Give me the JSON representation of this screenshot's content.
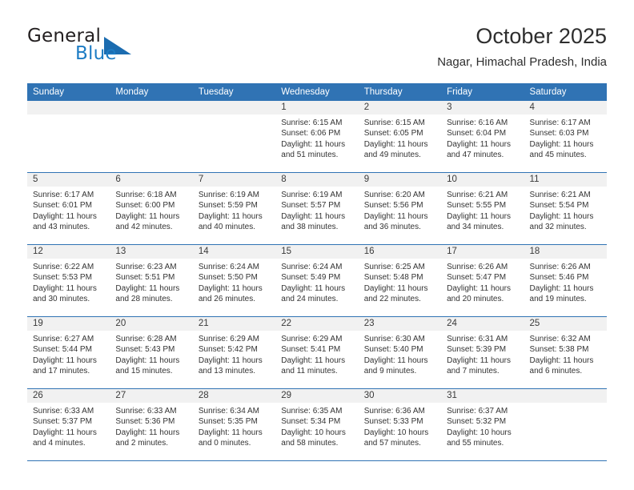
{
  "brand": {
    "name_part1": "General",
    "name_part2": "Blue",
    "triangle_color": "#1b6cb0",
    "blue_text_color": "#1d7cc4"
  },
  "header": {
    "title": "October 2025",
    "subtitle": "Nagar, Himachal Pradesh, India"
  },
  "theme": {
    "header_bg": "#3073b4",
    "daynum_band_bg": "#f1f1f1",
    "grid_line": "#3073b4",
    "text": "#333333"
  },
  "calendar": {
    "weekday_headers": [
      "Sunday",
      "Monday",
      "Tuesday",
      "Wednesday",
      "Thursday",
      "Friday",
      "Saturday"
    ],
    "weeks": [
      [
        {
          "day": "",
          "sunrise": "",
          "sunset": "",
          "daylight_line1": "",
          "daylight_line2": "",
          "empty": true
        },
        {
          "day": "",
          "sunrise": "",
          "sunset": "",
          "daylight_line1": "",
          "daylight_line2": "",
          "empty": true
        },
        {
          "day": "",
          "sunrise": "",
          "sunset": "",
          "daylight_line1": "",
          "daylight_line2": "",
          "empty": true
        },
        {
          "day": "1",
          "sunrise": "Sunrise: 6:15 AM",
          "sunset": "Sunset: 6:06 PM",
          "daylight_line1": "Daylight: 11 hours",
          "daylight_line2": "and 51 minutes."
        },
        {
          "day": "2",
          "sunrise": "Sunrise: 6:15 AM",
          "sunset": "Sunset: 6:05 PM",
          "daylight_line1": "Daylight: 11 hours",
          "daylight_line2": "and 49 minutes."
        },
        {
          "day": "3",
          "sunrise": "Sunrise: 6:16 AM",
          "sunset": "Sunset: 6:04 PM",
          "daylight_line1": "Daylight: 11 hours",
          "daylight_line2": "and 47 minutes."
        },
        {
          "day": "4",
          "sunrise": "Sunrise: 6:17 AM",
          "sunset": "Sunset: 6:03 PM",
          "daylight_line1": "Daylight: 11 hours",
          "daylight_line2": "and 45 minutes."
        }
      ],
      [
        {
          "day": "5",
          "sunrise": "Sunrise: 6:17 AM",
          "sunset": "Sunset: 6:01 PM",
          "daylight_line1": "Daylight: 11 hours",
          "daylight_line2": "and 43 minutes."
        },
        {
          "day": "6",
          "sunrise": "Sunrise: 6:18 AM",
          "sunset": "Sunset: 6:00 PM",
          "daylight_line1": "Daylight: 11 hours",
          "daylight_line2": "and 42 minutes."
        },
        {
          "day": "7",
          "sunrise": "Sunrise: 6:19 AM",
          "sunset": "Sunset: 5:59 PM",
          "daylight_line1": "Daylight: 11 hours",
          "daylight_line2": "and 40 minutes."
        },
        {
          "day": "8",
          "sunrise": "Sunrise: 6:19 AM",
          "sunset": "Sunset: 5:57 PM",
          "daylight_line1": "Daylight: 11 hours",
          "daylight_line2": "and 38 minutes."
        },
        {
          "day": "9",
          "sunrise": "Sunrise: 6:20 AM",
          "sunset": "Sunset: 5:56 PM",
          "daylight_line1": "Daylight: 11 hours",
          "daylight_line2": "and 36 minutes."
        },
        {
          "day": "10",
          "sunrise": "Sunrise: 6:21 AM",
          "sunset": "Sunset: 5:55 PM",
          "daylight_line1": "Daylight: 11 hours",
          "daylight_line2": "and 34 minutes."
        },
        {
          "day": "11",
          "sunrise": "Sunrise: 6:21 AM",
          "sunset": "Sunset: 5:54 PM",
          "daylight_line1": "Daylight: 11 hours",
          "daylight_line2": "and 32 minutes."
        }
      ],
      [
        {
          "day": "12",
          "sunrise": "Sunrise: 6:22 AM",
          "sunset": "Sunset: 5:53 PM",
          "daylight_line1": "Daylight: 11 hours",
          "daylight_line2": "and 30 minutes."
        },
        {
          "day": "13",
          "sunrise": "Sunrise: 6:23 AM",
          "sunset": "Sunset: 5:51 PM",
          "daylight_line1": "Daylight: 11 hours",
          "daylight_line2": "and 28 minutes."
        },
        {
          "day": "14",
          "sunrise": "Sunrise: 6:24 AM",
          "sunset": "Sunset: 5:50 PM",
          "daylight_line1": "Daylight: 11 hours",
          "daylight_line2": "and 26 minutes."
        },
        {
          "day": "15",
          "sunrise": "Sunrise: 6:24 AM",
          "sunset": "Sunset: 5:49 PM",
          "daylight_line1": "Daylight: 11 hours",
          "daylight_line2": "and 24 minutes."
        },
        {
          "day": "16",
          "sunrise": "Sunrise: 6:25 AM",
          "sunset": "Sunset: 5:48 PM",
          "daylight_line1": "Daylight: 11 hours",
          "daylight_line2": "and 22 minutes."
        },
        {
          "day": "17",
          "sunrise": "Sunrise: 6:26 AM",
          "sunset": "Sunset: 5:47 PM",
          "daylight_line1": "Daylight: 11 hours",
          "daylight_line2": "and 20 minutes."
        },
        {
          "day": "18",
          "sunrise": "Sunrise: 6:26 AM",
          "sunset": "Sunset: 5:46 PM",
          "daylight_line1": "Daylight: 11 hours",
          "daylight_line2": "and 19 minutes."
        }
      ],
      [
        {
          "day": "19",
          "sunrise": "Sunrise: 6:27 AM",
          "sunset": "Sunset: 5:44 PM",
          "daylight_line1": "Daylight: 11 hours",
          "daylight_line2": "and 17 minutes."
        },
        {
          "day": "20",
          "sunrise": "Sunrise: 6:28 AM",
          "sunset": "Sunset: 5:43 PM",
          "daylight_line1": "Daylight: 11 hours",
          "daylight_line2": "and 15 minutes."
        },
        {
          "day": "21",
          "sunrise": "Sunrise: 6:29 AM",
          "sunset": "Sunset: 5:42 PM",
          "daylight_line1": "Daylight: 11 hours",
          "daylight_line2": "and 13 minutes."
        },
        {
          "day": "22",
          "sunrise": "Sunrise: 6:29 AM",
          "sunset": "Sunset: 5:41 PM",
          "daylight_line1": "Daylight: 11 hours",
          "daylight_line2": "and 11 minutes."
        },
        {
          "day": "23",
          "sunrise": "Sunrise: 6:30 AM",
          "sunset": "Sunset: 5:40 PM",
          "daylight_line1": "Daylight: 11 hours",
          "daylight_line2": "and 9 minutes."
        },
        {
          "day": "24",
          "sunrise": "Sunrise: 6:31 AM",
          "sunset": "Sunset: 5:39 PM",
          "daylight_line1": "Daylight: 11 hours",
          "daylight_line2": "and 7 minutes."
        },
        {
          "day": "25",
          "sunrise": "Sunrise: 6:32 AM",
          "sunset": "Sunset: 5:38 PM",
          "daylight_line1": "Daylight: 11 hours",
          "daylight_line2": "and 6 minutes."
        }
      ],
      [
        {
          "day": "26",
          "sunrise": "Sunrise: 6:33 AM",
          "sunset": "Sunset: 5:37 PM",
          "daylight_line1": "Daylight: 11 hours",
          "daylight_line2": "and 4 minutes."
        },
        {
          "day": "27",
          "sunrise": "Sunrise: 6:33 AM",
          "sunset": "Sunset: 5:36 PM",
          "daylight_line1": "Daylight: 11 hours",
          "daylight_line2": "and 2 minutes."
        },
        {
          "day": "28",
          "sunrise": "Sunrise: 6:34 AM",
          "sunset": "Sunset: 5:35 PM",
          "daylight_line1": "Daylight: 11 hours",
          "daylight_line2": "and 0 minutes."
        },
        {
          "day": "29",
          "sunrise": "Sunrise: 6:35 AM",
          "sunset": "Sunset: 5:34 PM",
          "daylight_line1": "Daylight: 10 hours",
          "daylight_line2": "and 58 minutes."
        },
        {
          "day": "30",
          "sunrise": "Sunrise: 6:36 AM",
          "sunset": "Sunset: 5:33 PM",
          "daylight_line1": "Daylight: 10 hours",
          "daylight_line2": "and 57 minutes."
        },
        {
          "day": "31",
          "sunrise": "Sunrise: 6:37 AM",
          "sunset": "Sunset: 5:32 PM",
          "daylight_line1": "Daylight: 10 hours",
          "daylight_line2": "and 55 minutes."
        },
        {
          "day": "",
          "sunrise": "",
          "sunset": "",
          "daylight_line1": "",
          "daylight_line2": "",
          "empty": true
        }
      ]
    ]
  }
}
